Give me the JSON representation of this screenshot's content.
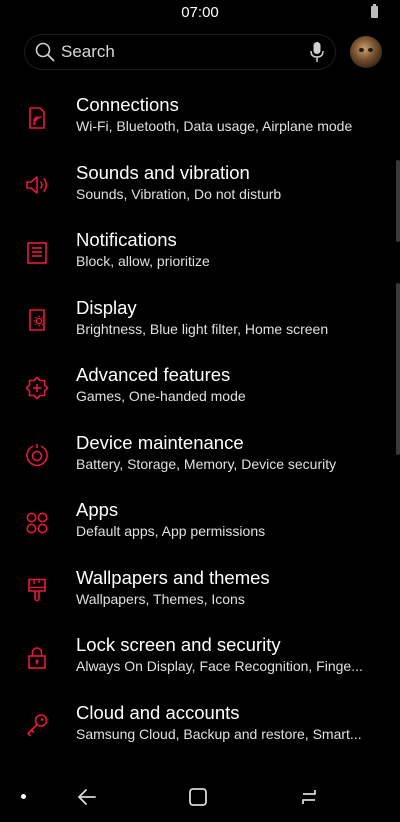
{
  "status_bar": {
    "time": "07:00"
  },
  "search": {
    "placeholder": "Search"
  },
  "accent_color": "#e8173c",
  "settings_items": [
    {
      "title": "Connections",
      "subtitle": "Wi-Fi, Bluetooth, Data usage, Airplane mode",
      "icon": "connections-icon"
    },
    {
      "title": "Sounds and vibration",
      "subtitle": "Sounds, Vibration, Do not disturb",
      "icon": "speaker-icon"
    },
    {
      "title": "Notifications",
      "subtitle": "Block, allow, prioritize",
      "icon": "notifications-icon"
    },
    {
      "title": "Display",
      "subtitle": "Brightness, Blue light filter, Home screen",
      "icon": "display-icon"
    },
    {
      "title": "Advanced features",
      "subtitle": "Games, One-handed mode",
      "icon": "advanced-features-icon"
    },
    {
      "title": "Device maintenance",
      "subtitle": "Battery, Storage, Memory, Device security",
      "icon": "device-maintenance-icon"
    },
    {
      "title": "Apps",
      "subtitle": "Default apps, App permissions",
      "icon": "apps-icon"
    },
    {
      "title": "Wallpapers and themes",
      "subtitle": "Wallpapers, Themes, Icons",
      "icon": "brush-icon"
    },
    {
      "title": "Lock screen and security",
      "subtitle": "Always On Display, Face Recognition, Finge...",
      "icon": "lock-icon"
    },
    {
      "title": "Cloud and accounts",
      "subtitle": "Samsung Cloud, Backup and restore, Smart...",
      "icon": "key-icon"
    }
  ]
}
